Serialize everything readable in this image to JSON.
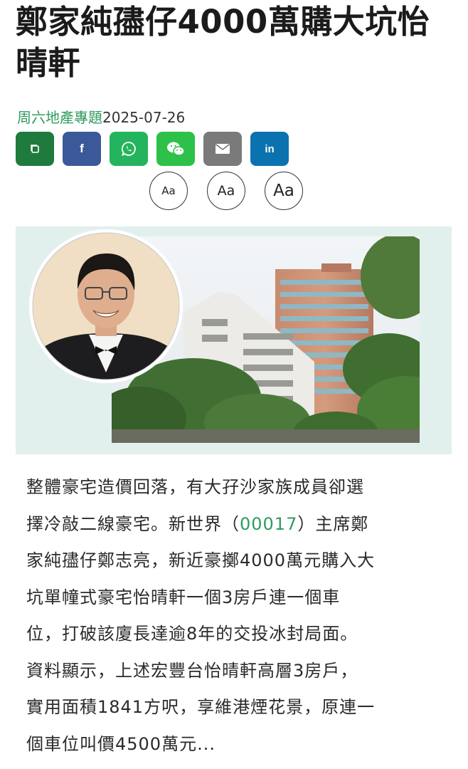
{
  "article": {
    "title": "鄭家純孻仔4000萬購大坑怡晴軒",
    "category": "周六地產專題",
    "date": "2025-07-26"
  },
  "share": [
    {
      "name": "copy",
      "icon": "copy-icon",
      "color": "#1f7a3e"
    },
    {
      "name": "facebook",
      "icon": "facebook-icon",
      "label": "f",
      "color": "#3b5998"
    },
    {
      "name": "whatsapp",
      "icon": "whatsapp-icon",
      "color": "#25b45e"
    },
    {
      "name": "wechat",
      "icon": "wechat-icon",
      "color": "#2dc14a"
    },
    {
      "name": "email",
      "icon": "email-icon",
      "color": "#7a7a7a"
    },
    {
      "name": "linkedin",
      "icon": "linkedin-icon",
      "label": "in",
      "color": "#0b72b0"
    }
  ],
  "font_size": {
    "small": "Aa",
    "medium": "Aa",
    "large": "Aa"
  },
  "body": {
    "line1": "整體豪宅造價回落，有大孖沙家族成員卻選",
    "line2_a": "擇冷敲二線豪宅。新世界（",
    "line2_stock": "00017",
    "line2_b": "）主席鄭",
    "line3": "家純孻仔鄭志亮，新近豪擲4000萬元購入大",
    "line4": "坑單幢式豪宅怡晴軒一個3房戶連一個車",
    "line5": "位，打破該廈長達逾8年的交投冰封局面。",
    "line6": "資料顯示，上述宏豐台怡晴軒高層3房戶，",
    "line7": "實用面積1841方呎，享維港煙花景，原連一",
    "line8": "個車位叫價4500萬元..."
  }
}
